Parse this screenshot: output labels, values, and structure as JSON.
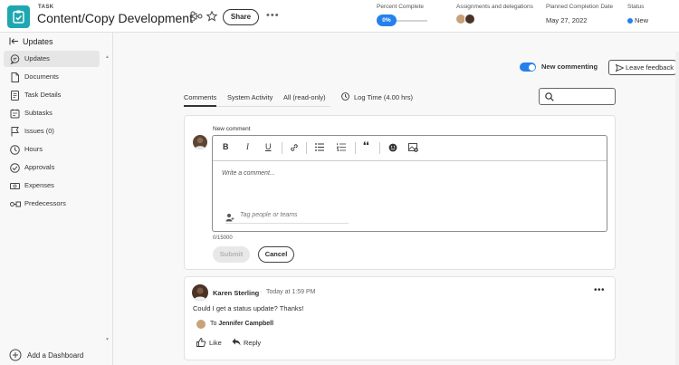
{
  "header": {
    "kind": "TASK",
    "title": "Content/Copy Development",
    "share_label": "Share",
    "more_label": "•••",
    "percent_complete": {
      "label": "Percent Complete",
      "value": "0%"
    },
    "assignments": {
      "label": "Assignments and delegations"
    },
    "planned_completion": {
      "label": "Planned Completion Date",
      "value": "May 27, 2022"
    },
    "status": {
      "label": "Status",
      "value": "New",
      "color": "#2680eb"
    }
  },
  "sidebar": {
    "collapse_label": "Updates",
    "items": [
      {
        "label": "Updates",
        "icon": "chat-bubble-icon",
        "active": true
      },
      {
        "label": "Documents",
        "icon": "document-icon"
      },
      {
        "label": "Task Details",
        "icon": "task-details-icon"
      },
      {
        "label": "Subtasks",
        "icon": "subtasks-icon"
      },
      {
        "label": "Issues (0)",
        "icon": "issues-icon"
      },
      {
        "label": "Hours",
        "icon": "clock-icon"
      },
      {
        "label": "Approvals",
        "icon": "checkmark-circle-icon"
      },
      {
        "label": "Expenses",
        "icon": "money-icon"
      },
      {
        "label": "Predecessors",
        "icon": "predecessors-icon"
      }
    ],
    "add_dashboard_label": "Add a Dashboard"
  },
  "updates": {
    "new_commenting_label": "New commenting",
    "new_commenting_on": true,
    "feedback_label": "Leave feedback",
    "tabs": [
      "Comments",
      "System Activity",
      "All (read-only)"
    ],
    "active_tab": "Comments",
    "log_time_label": "Log Time (4.00 hrs)",
    "search_placeholder": ""
  },
  "composer": {
    "label": "New comment",
    "placeholder": "Write a comment...",
    "tag_placeholder": "Tag people or teams",
    "char_count": "0/15000",
    "submit_label": "Submit",
    "cancel_label": "Cancel",
    "toolbar": {
      "bold": "B",
      "italic": "I",
      "underline": "U",
      "quote": "❛❛"
    }
  },
  "comment": {
    "author": "Karen Sterling",
    "separator": "·",
    "timestamp": "Today at 1:59 PM",
    "more_label": "•••",
    "body": "Could I get a status update? Thanks!",
    "to_prefix": "To",
    "to_name": "Jennifer Campbell",
    "like_label": "Like",
    "reply_label": "Reply"
  },
  "colors": {
    "accent": "#2680eb",
    "task_icon": "#1fa7b0"
  }
}
